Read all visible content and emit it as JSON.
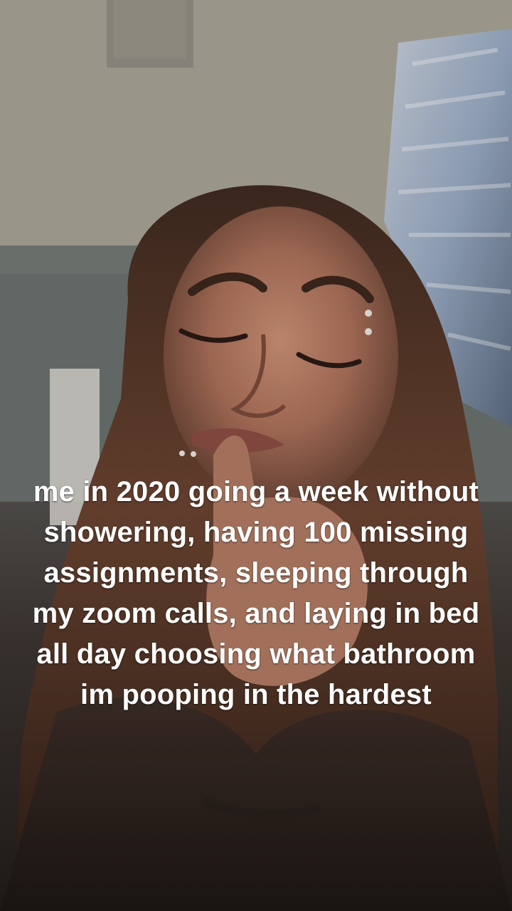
{
  "video": {
    "caption": "me in 2020 going a week without showering, having 100 missing assignments, sleeping through my zoom calls, and laying in bed all day choosing what bathroom im pooping in the hardest"
  },
  "colors": {
    "caption_text": "#ffffff",
    "ceiling": "#a7a293",
    "wall": "#69706d",
    "hair": "#4a3022",
    "skin": "#a7715a",
    "curtain": "#8ea3c0"
  }
}
